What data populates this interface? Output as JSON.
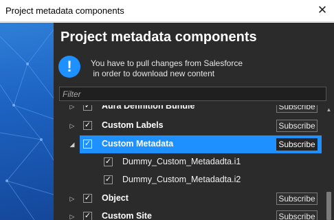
{
  "window": {
    "title": "Project metadata components",
    "close_glyph": "✕"
  },
  "panel": {
    "heading": "Project metadata components",
    "info_glyph": "!",
    "info_line1": "You have to pull changes from Salesforce",
    "info_line2": " in order to download new content",
    "filter_placeholder": "Filter",
    "filter_value": ""
  },
  "tree": {
    "rows": [
      {
        "label": "Aura Definition Bundle",
        "expander": "▷",
        "checked": "✓",
        "button": "Subscribe",
        "level": 0
      },
      {
        "label": "Custom Labels",
        "expander": "▷",
        "checked": "✓",
        "button": "Subscribe",
        "level": 0
      },
      {
        "label": "Custom Metadata",
        "expander": "◢",
        "checked": "✓",
        "button": "Subscribe",
        "level": 0,
        "selected": true
      },
      {
        "label": "Dummy_Custom_Metadadta.i1",
        "checked": "✓",
        "level": 1
      },
      {
        "label": "Dummy_Custom_Metadadta.i2",
        "checked": "✓",
        "level": 1
      },
      {
        "label": "Object",
        "expander": "▷",
        "checked": "✓",
        "button": "Subscribe",
        "level": 0
      },
      {
        "label": "Custom Site",
        "expander": "▷",
        "checked": "✓",
        "button": "Subscribe",
        "level": 0
      }
    ]
  },
  "scrollbar": {
    "up_glyph": "▲"
  },
  "colors": {
    "accent": "#1e90ff",
    "panel_bg": "#2b2b2b",
    "side_bg": "#1d63c2"
  }
}
